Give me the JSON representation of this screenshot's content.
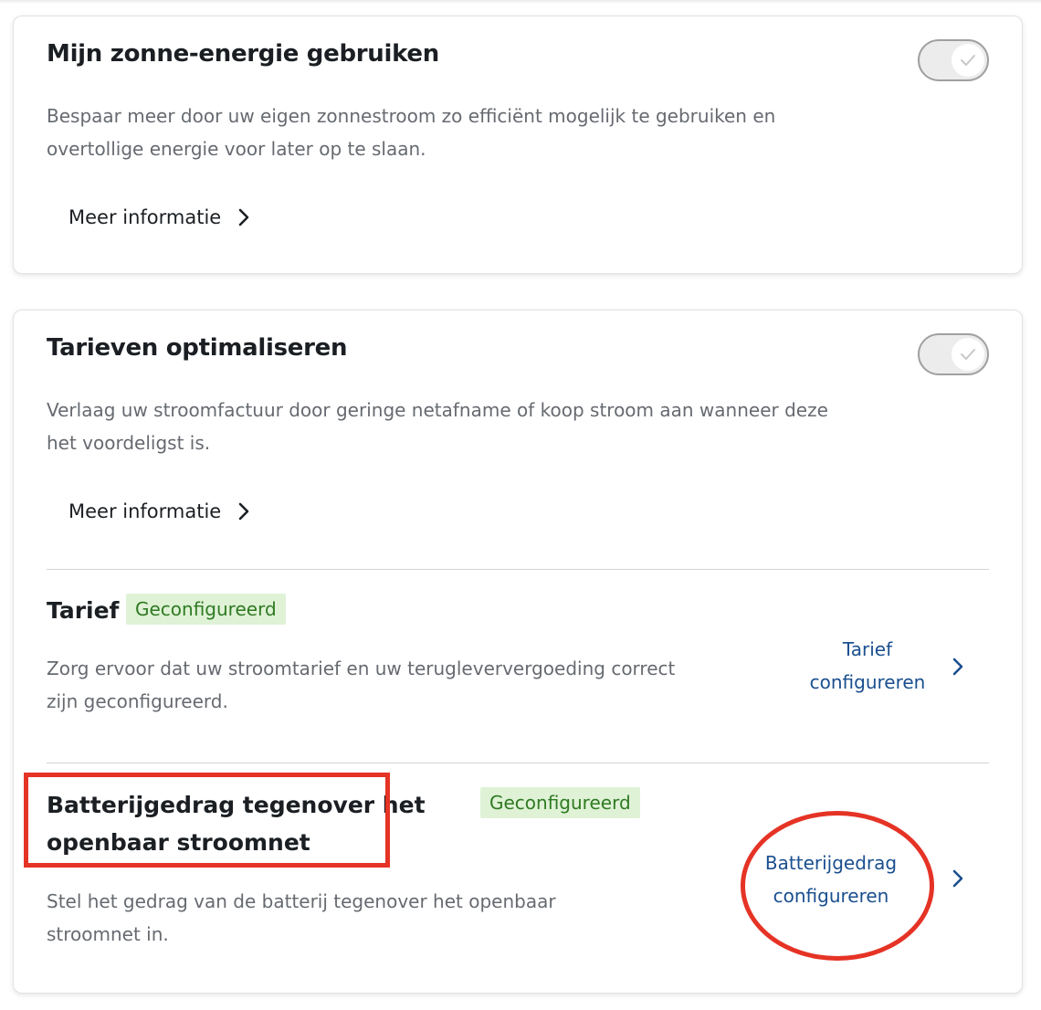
{
  "card1": {
    "title": "Mijn zonne-energie gebruiken",
    "description_line1": "Bespaar meer door uw eigen zonnestroom zo efficiënt mogelijk te gebruiken en",
    "description_line2": "overtollige energie voor later op te slaan.",
    "more_label": "Meer informatie",
    "toggle_icon": "check-icon"
  },
  "card2": {
    "title": "Tarieven optimaliseren",
    "description_line1": "Verlaag uw stroomfactuur door geringe netafname of koop stroom aan wanneer deze",
    "description_line2": "het voordeligst is.",
    "more_label": "Meer informatie",
    "toggle_icon": "check-icon",
    "tariff": {
      "title": "Tarief",
      "badge": "Geconfigureerd",
      "description_line1": "Zorg ervoor dat uw stroomtarief en uw terugleververgoeding correct",
      "description_line2": "zijn geconfigureerd.",
      "action_line1": "Tarief",
      "action_line2": "configureren"
    },
    "battery": {
      "title_line1": "Batterijgedrag tegenover het",
      "title_line2": "openbaar stroomnet",
      "badge": "Geconfigureerd",
      "description_line1": "Stel het gedrag van de batterij tegenover het openbaar",
      "description_line2": "stroomnet in.",
      "action_line1": "Batterijgedrag",
      "action_line2": "configureren"
    }
  },
  "colors": {
    "accent_link": "#1b4f8f",
    "badge_bg": "#dff2d6",
    "badge_text": "#2f7a23",
    "annotation_red": "#e53325"
  }
}
